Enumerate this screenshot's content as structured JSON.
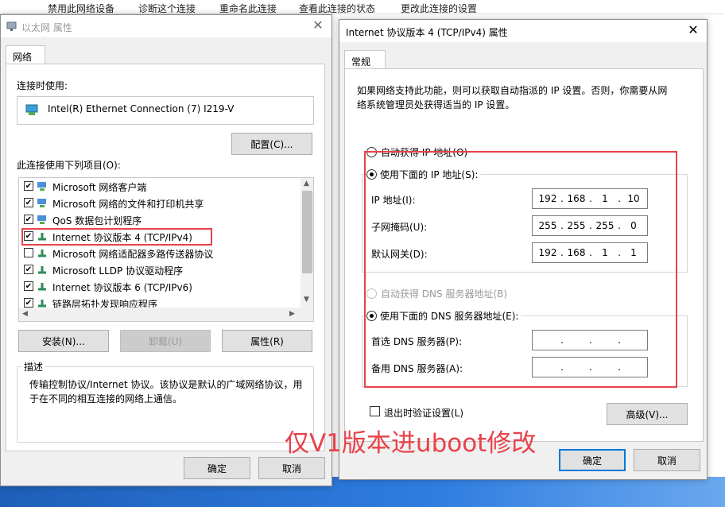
{
  "background": {
    "top_menu": [
      "禁用此网络设备",
      "诊断这个连接",
      "重命名此连接",
      "查看此连接的状态",
      "更改此连接的设置"
    ]
  },
  "ethernet_props": {
    "title": "以太网 属性",
    "tab": "网络",
    "connect_using_label": "连接时使用:",
    "adapter_name": "Intel(R) Ethernet Connection (7) I219-V",
    "configure_button": "配置(C)...",
    "items_label": "此连接使用下列项目(O):",
    "items": [
      {
        "label": "Microsoft 网络客户端",
        "checked": true
      },
      {
        "label": "Microsoft 网络的文件和打印机共享",
        "checked": true
      },
      {
        "label": "QoS 数据包计划程序",
        "checked": true
      },
      {
        "label": "Internet 协议版本 4 (TCP/IPv4)",
        "checked": true
      },
      {
        "label": "Microsoft 网络适配器多路传送器协议",
        "checked": false
      },
      {
        "label": "Microsoft LLDP 协议驱动程序",
        "checked": true
      },
      {
        "label": "Internet 协议版本 6 (TCP/IPv6)",
        "checked": true
      },
      {
        "label": "链路层拓扑发现响应程序",
        "checked": true
      }
    ],
    "install_button": "安装(N)...",
    "uninstall_button": "卸载(U)",
    "properties_button": "属性(R)",
    "description_title": "描述",
    "description_text_1": "传输控制协议/Internet 协议。该协议是默认的广域网络协议，用",
    "description_text_2": "于在不同的相互连接的网络上通信。",
    "ok_button": "确定",
    "cancel_button": "取消"
  },
  "ipv4_props": {
    "title": "Internet 协议版本 4 (TCP/IPv4) 属性",
    "tab": "常规",
    "intro_1": "如果网络支持此功能，则可以获取自动指派的 IP 设置。否则，你需要从网",
    "intro_2": "络系统管理员处获得适当的 IP 设置。",
    "auto_ip": "自动获得 IP 地址(O)",
    "use_ip": "使用下面的 IP 地址(S):",
    "ip_label": "IP 地址(I):",
    "ip_value": [
      "192",
      "168",
      "1",
      "10"
    ],
    "mask_label": "子网掩码(U):",
    "mask_value": [
      "255",
      "255",
      "255",
      "0"
    ],
    "gateway_label": "默认网关(D):",
    "gateway_value": [
      "192",
      "168",
      "1",
      "1"
    ],
    "auto_dns": "自动获得 DNS 服务器地址(B)",
    "use_dns": "使用下面的 DNS 服务器地址(E):",
    "preferred_dns_label": "首选 DNS 服务器(P):",
    "alternate_dns_label": "备用 DNS 服务器(A):",
    "validate_on_exit": "退出时验证设置(L)",
    "advanced_button": "高级(V)...",
    "ok_button": "确定",
    "cancel_button": "取消"
  },
  "annotation": {
    "text": "仅V1版本进uboot修改",
    "color": "#e8424a"
  }
}
